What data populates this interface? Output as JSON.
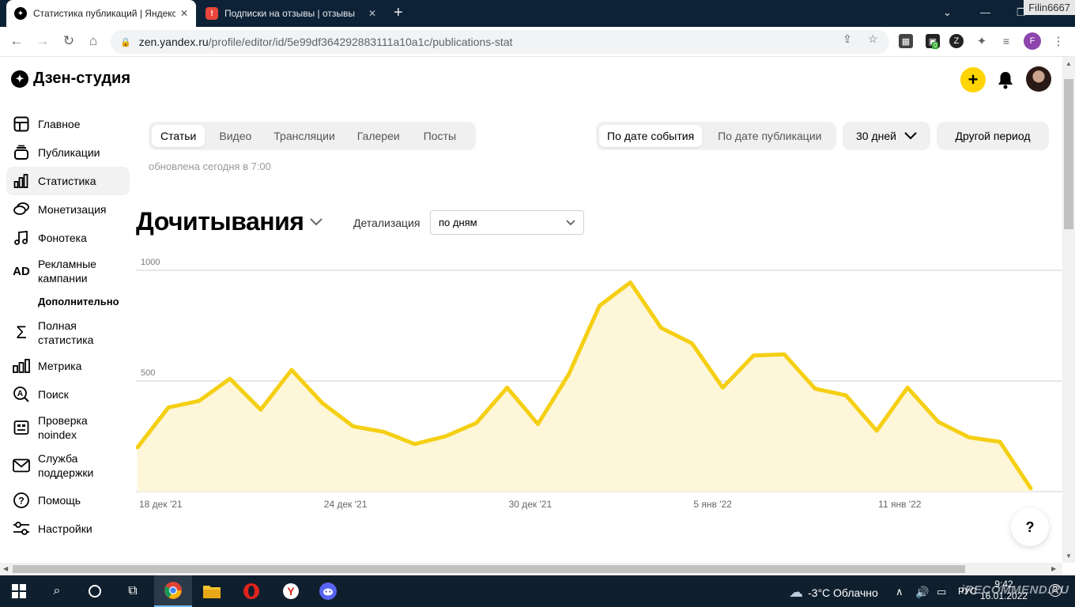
{
  "browser": {
    "tabs": [
      {
        "title": "Статистика публикаций | Яндекс",
        "active": true
      },
      {
        "title": "Подписки на отзывы | отзывы",
        "active": false
      }
    ],
    "new_tab": "+",
    "user_badge": "Filin6667",
    "url_host": "zen.yandex.ru",
    "url_path": "/profile/editor/id/5e99df364292883111a10a1c/publications-stat",
    "profile_letter": "F",
    "extension_badge": "0"
  },
  "app": {
    "logo_text": "Дзен-студия"
  },
  "sidebar": {
    "items": [
      {
        "label": "Главное",
        "icon": "layout-icon"
      },
      {
        "label": "Публикации",
        "icon": "stack-icon"
      },
      {
        "label": "Статистика",
        "icon": "bar-chart-icon",
        "active": true
      },
      {
        "label": "Монетизация",
        "icon": "coins-icon"
      },
      {
        "label": "Фонотека",
        "icon": "music-icon"
      },
      {
        "label": "Рекламные кампании",
        "icon": "ad-icon"
      }
    ],
    "extra_heading": "Дополнительно",
    "extra_items": [
      {
        "label": "Полная статистика",
        "icon": "sigma-icon"
      },
      {
        "label": "Метрика",
        "icon": "metrics-icon"
      },
      {
        "label": "Поиск",
        "icon": "search-a-icon"
      },
      {
        "label": "Проверка noindex",
        "icon": "noindex-icon"
      },
      {
        "label": "Служба поддержки",
        "icon": "mail-icon"
      },
      {
        "label": "Помощь",
        "icon": "help-icon"
      },
      {
        "label": "Настройки",
        "icon": "sliders-icon"
      }
    ],
    "ad_icon_text": "AD"
  },
  "content_tabs": [
    "Статьи",
    "Видео",
    "Трансляции",
    "Галереи",
    "Посты"
  ],
  "selected_content_tab": "Статьи",
  "date_mode": [
    "По дате события",
    "По дате публикации"
  ],
  "selected_date_mode": "По дате события",
  "period": "30 дней",
  "other_period": "Другой период",
  "updated_text": "обновлена сегодня в 7:00",
  "metric_title": "Дочитывания",
  "detail_label": "Детализация",
  "detail_value": "по дням",
  "help_button": "?",
  "chart_data": {
    "type": "area",
    "title": "Дочитывания",
    "xlabel": "",
    "ylabel": "",
    "ylim": [
      0,
      1000
    ],
    "yticks": [
      "1000",
      "500",
      "0"
    ],
    "xtick_labels": [
      {
        "label": "18 дек '21",
        "index": 0
      },
      {
        "label": "24 дек '21",
        "index": 6
      },
      {
        "label": "30 дек '21",
        "index": 12
      },
      {
        "label": "5 янв '22",
        "index": 18
      },
      {
        "label": "11 янв '22",
        "index": 24
      }
    ],
    "x": [
      "18 дек",
      "19 дек",
      "20 дек",
      "21 дек",
      "22 дек",
      "23 дек",
      "24 дек",
      "25 дек",
      "26 дек",
      "27 дек",
      "28 дек",
      "29 дек",
      "30 дек",
      "31 дек",
      "1 янв",
      "2 янв",
      "3 янв",
      "4 янв",
      "5 янв",
      "6 янв",
      "7 янв",
      "8 янв",
      "9 янв",
      "10 янв",
      "11 янв",
      "12 янв",
      "13 янв",
      "14 янв",
      "15 янв",
      "16 янв"
    ],
    "values": [
      200,
      380,
      410,
      510,
      370,
      550,
      400,
      295,
      270,
      215,
      250,
      310,
      470,
      305,
      530,
      840,
      945,
      740,
      670,
      470,
      615,
      620,
      465,
      435,
      275,
      470,
      315,
      245,
      225,
      15
    ],
    "color": "#f5cf13",
    "fill": "#fdf6d8",
    "grid": true
  },
  "taskbar": {
    "weather": "-3°C  Облачно",
    "lang": "РУС",
    "time": "9:42",
    "date": "16.01.2022",
    "notifications": "2"
  },
  "watermark": "iRECOMMEND.RU"
}
